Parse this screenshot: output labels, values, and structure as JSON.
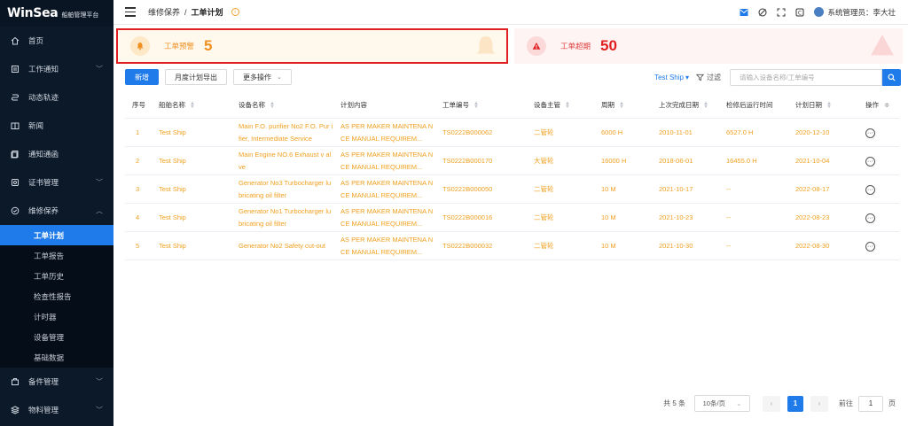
{
  "app": {
    "brand": "WinSea",
    "subtitle": "船舶管理平台"
  },
  "sidebar": {
    "items": [
      {
        "label": "首页",
        "icon": "home-icon",
        "arrow": false
      },
      {
        "label": "工作通知",
        "icon": "notice-icon",
        "arrow": true
      },
      {
        "label": "动态轨迹",
        "icon": "track-icon",
        "arrow": false
      },
      {
        "label": "新闻",
        "icon": "news-icon",
        "arrow": false
      },
      {
        "label": "通知通函",
        "icon": "circular-icon",
        "arrow": false
      },
      {
        "label": "证书管理",
        "icon": "certificate-icon",
        "arrow": true
      },
      {
        "label": "维修保养",
        "icon": "maintenance-icon",
        "arrow": true,
        "open": true
      }
    ],
    "subitems": [
      "工单计划",
      "工单报告",
      "工单历史",
      "检查性报告",
      "计时器",
      "设备管理",
      "基础数据"
    ],
    "active_sub": "工单计划",
    "bottom_items": [
      {
        "label": "备件管理",
        "icon": "spare-parts-icon",
        "arrow": true
      },
      {
        "label": "物料管理",
        "icon": "material-icon",
        "arrow": true
      }
    ]
  },
  "header": {
    "breadcrumb_parent": "维修保养",
    "breadcrumb_sep": "/",
    "breadcrumb_current": "工单计划",
    "user_label": "系统管理员：李大壮"
  },
  "alerts": {
    "warning": {
      "label": "工单预警",
      "value": "5"
    },
    "overdue": {
      "label": "工单超期",
      "value": "50"
    }
  },
  "toolbar": {
    "add": "新增",
    "export": "月度计划导出",
    "more": "更多操作",
    "ship": "Test Ship",
    "filter": "过滤",
    "search_placeholder": "请输入设备名称/工单编号"
  },
  "table": {
    "columns": [
      "序号",
      "船舶名称",
      "设备名称",
      "计划内容",
      "工单编号",
      "设备主管",
      "周期",
      "上次完成日期",
      "检修后运行时间",
      "计划日期",
      "操作"
    ],
    "rows": [
      [
        "1",
        "Test Ship",
        "Main F.O. purifier No2 F.O. Pur ifier, Intermediate Service",
        "AS PER MAKER MAINTENA NCE MANUAL REQUIREM...",
        "TS0222B000062",
        "二管轮",
        "6000 H",
        "2010-11-01",
        "6527.0 H",
        "2020-12-10"
      ],
      [
        "2",
        "Test Ship",
        "Main Engine NO.6 Exhaust v alve",
        "AS PER MAKER MAINTENA NCE MANUAL REQUIREM...",
        "TS0222B000170",
        "大管轮",
        "16000 H",
        "2018-06-01",
        "16455.0 H",
        "2021-10-04"
      ],
      [
        "3",
        "Test Ship",
        "Generator No3 Turbocharger lubricating oil filter",
        "AS PER MAKER MAINTENA NCE MANUAL REQUIREM...",
        "TS0222B000050",
        "二管轮",
        "10 M",
        "2021-10-17",
        "--",
        "2022-08-17"
      ],
      [
        "4",
        "Test Ship",
        "Generator No1 Turbocharger lubricating oil filter",
        "AS PER MAKER MAINTENA NCE MANUAL REQUIREM...",
        "TS0222B000016",
        "二管轮",
        "10 M",
        "2021-10-23",
        "--",
        "2022-08-23"
      ],
      [
        "5",
        "Test Ship",
        "Generator No2 Safety cut-out",
        "AS PER MAKER MAINTENA NCE MANUAL REQUIREM...",
        "TS0222B000032",
        "二管轮",
        "10 M",
        "2021-10-30",
        "--",
        "2022-08-30"
      ]
    ]
  },
  "pager": {
    "total": "共 5 条",
    "page_size": "10条/页",
    "current": "1",
    "goto_label": "前往",
    "goto_value": "1",
    "page_unit": "页"
  },
  "colors": {
    "accent": "#1f7bea",
    "row_text": "#f0a020",
    "warning": "#f09020",
    "overdue": "#e02020",
    "sidebar_bg": "#0c1929"
  }
}
